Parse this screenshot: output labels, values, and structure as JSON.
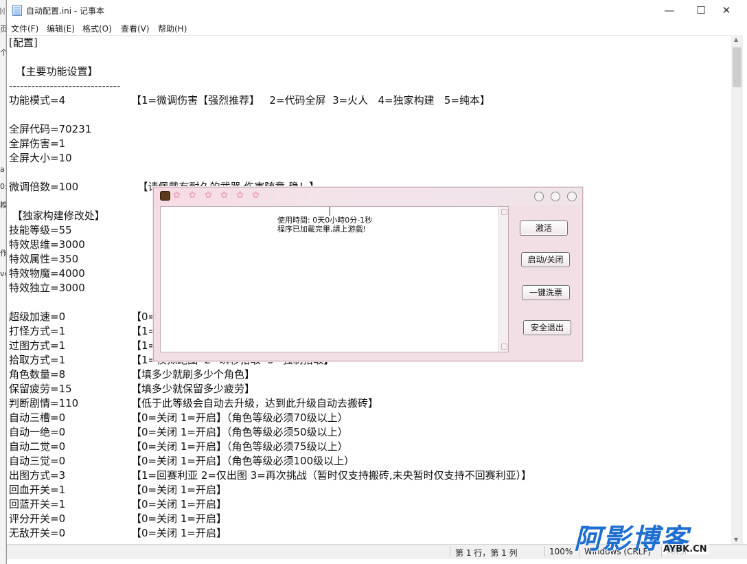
{
  "desktop_edge": {
    "glyphs": [
      "ᛞ",
      "页",
      "个",
      "a",
      "0:",
      "糗",
      "作",
      "ve"
    ]
  },
  "window": {
    "title": "自动配置.ini - 记事本",
    "minimize": "—",
    "maximize": "☐",
    "close": "✕"
  },
  "menu": [
    "文件(F)",
    "编辑(E)",
    "格式(O)",
    "查看(V)",
    "帮助(H)"
  ],
  "lines": [
    {
      "k": "[配置]",
      "c": ""
    },
    {
      "k": "",
      "c": ""
    },
    {
      "k": "  【主要功能设置】",
      "c": ""
    },
    {
      "k": "------------------------------",
      "c": ""
    },
    {
      "k": "功能模式=4",
      "c": "【1=微调伤害【强烈推荐】   2=代码全屏  3=火人   4=独家构建   5=纯本】"
    },
    {
      "k": "",
      "c": ""
    },
    {
      "k": "全屏代码=70231",
      "c": ""
    },
    {
      "k": "全屏伤害=1",
      "c": ""
    },
    {
      "k": "全屏大小=10",
      "c": ""
    },
    {
      "k": "",
      "c": ""
    },
    {
      "k": "微调倍数=100",
      "c": "  【请佩戴有耐久的武器 伤害随意 稳！】"
    },
    {
      "k": "",
      "c": ""
    },
    {
      "k": " 【独家构建修改处】",
      "c": ""
    },
    {
      "k": "技能等级=55",
      "c": ""
    },
    {
      "k": "特效思维=3000",
      "c": ""
    },
    {
      "k": "特效属性=350",
      "c": ""
    },
    {
      "k": "特效物魔=4000",
      "c": ""
    },
    {
      "k": "特效独立=3000",
      "c": ""
    },
    {
      "k": "",
      "c": ""
    },
    {
      "k": "超级加速=0",
      "c": "【0="
    },
    {
      "k": "打怪方式=1",
      "c": "【1="
    },
    {
      "k": "过图方式=1",
      "c": "【1="
    },
    {
      "k": "拾取方式=1",
      "c": "【1=模拟跑图  2=瞬移拾取  3=强制拾取】"
    },
    {
      "k": "角色数量=8",
      "c": "【填多少就刷多少个角色】"
    },
    {
      "k": "保留疲劳=15",
      "c": "【填多少就保留多少疲劳】"
    },
    {
      "k": "判断剧情=110",
      "c": "【低于此等级会自动去升级，达到此升级自动去搬砖】"
    },
    {
      "k": "自动三槽=0",
      "c": "【0=关闭 1=开启】（角色等级必须70级以上）"
    },
    {
      "k": "自动一绝=0",
      "c": "【0=关闭 1=开启】（角色等级必须50级以上）"
    },
    {
      "k": "自动二觉=0",
      "c": "【0=关闭 1=开启】（角色等级必须75级以上）"
    },
    {
      "k": "自动三觉=0",
      "c": "【0=关闭 1=开启】（角色等级必须100级以上）"
    },
    {
      "k": "出图方式=3",
      "c": "【1=回赛利亚 2=仅出图 3=再次挑战（暂时仅支持搬砖,未央暂时仅支持不回赛利亚）】"
    },
    {
      "k": "回血开关=1",
      "c": "【0=关闭 1=开启】"
    },
    {
      "k": "回蓝开关=1",
      "c": "【0=关闭 1=开启】"
    },
    {
      "k": "评分开关=0",
      "c": "【0=关闭 1=开启】"
    },
    {
      "k": "无敌开关=0",
      "c": "【0=关闭 1=开启】"
    }
  ],
  "status": {
    "position": "第 1 行，第 1 列",
    "zoom": "100%",
    "eol": "Windows (CRLF)",
    "encoding": "ANSI"
  },
  "cheat": {
    "log": [
      "使用時間: 0天0小時0分-1秒",
      "程序已加載完畢,請上游戲!"
    ],
    "buttons": [
      "激活",
      "启动/关闭",
      "一键洗票",
      "安全退出"
    ],
    "flowers": "✿ ✿ ✿ ✿ ✿ ✿"
  },
  "watermark": {
    "big": "阿影博客",
    "small": "AYBK.CN"
  }
}
